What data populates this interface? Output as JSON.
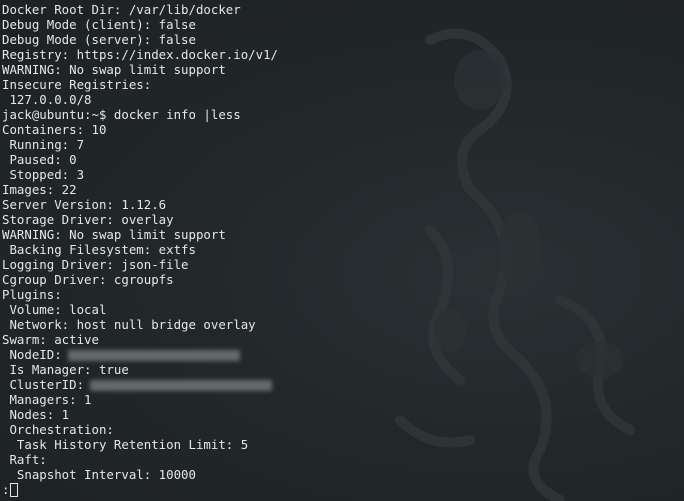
{
  "terminal": {
    "background": "#1e2325",
    "foreground": "#e6e6e6",
    "lines": [
      "Docker Root Dir: /var/lib/docker",
      "Debug Mode (client): false",
      "Debug Mode (server): false",
      "Registry: https://index.docker.io/v1/",
      "WARNING: No swap limit support",
      "Insecure Registries:",
      " 127.0.0.0/8",
      "jack@ubuntu:~$ docker info |less",
      "Containers: 10",
      " Running: 7",
      " Paused: 0",
      " Stopped: 3",
      "Images: 22",
      "Server Version: 1.12.6",
      "Storage Driver: overlay",
      "WARNING: No swap limit support",
      " Backing Filesystem: extfs",
      "Logging Driver: json-file",
      "Cgroup Driver: cgroupfs",
      "Plugins:",
      " Volume: local",
      " Network: host null bridge overlay",
      "Swarm: active",
      " NodeID:",
      " Is Manager: true",
      " ClusterID:",
      " Managers: 1",
      " Nodes: 1",
      " Orchestration:",
      "  Task History Retention Limit: 5",
      " Raft:",
      "  Snapshot Interval: 10000"
    ],
    "pager_prompt": ":"
  }
}
